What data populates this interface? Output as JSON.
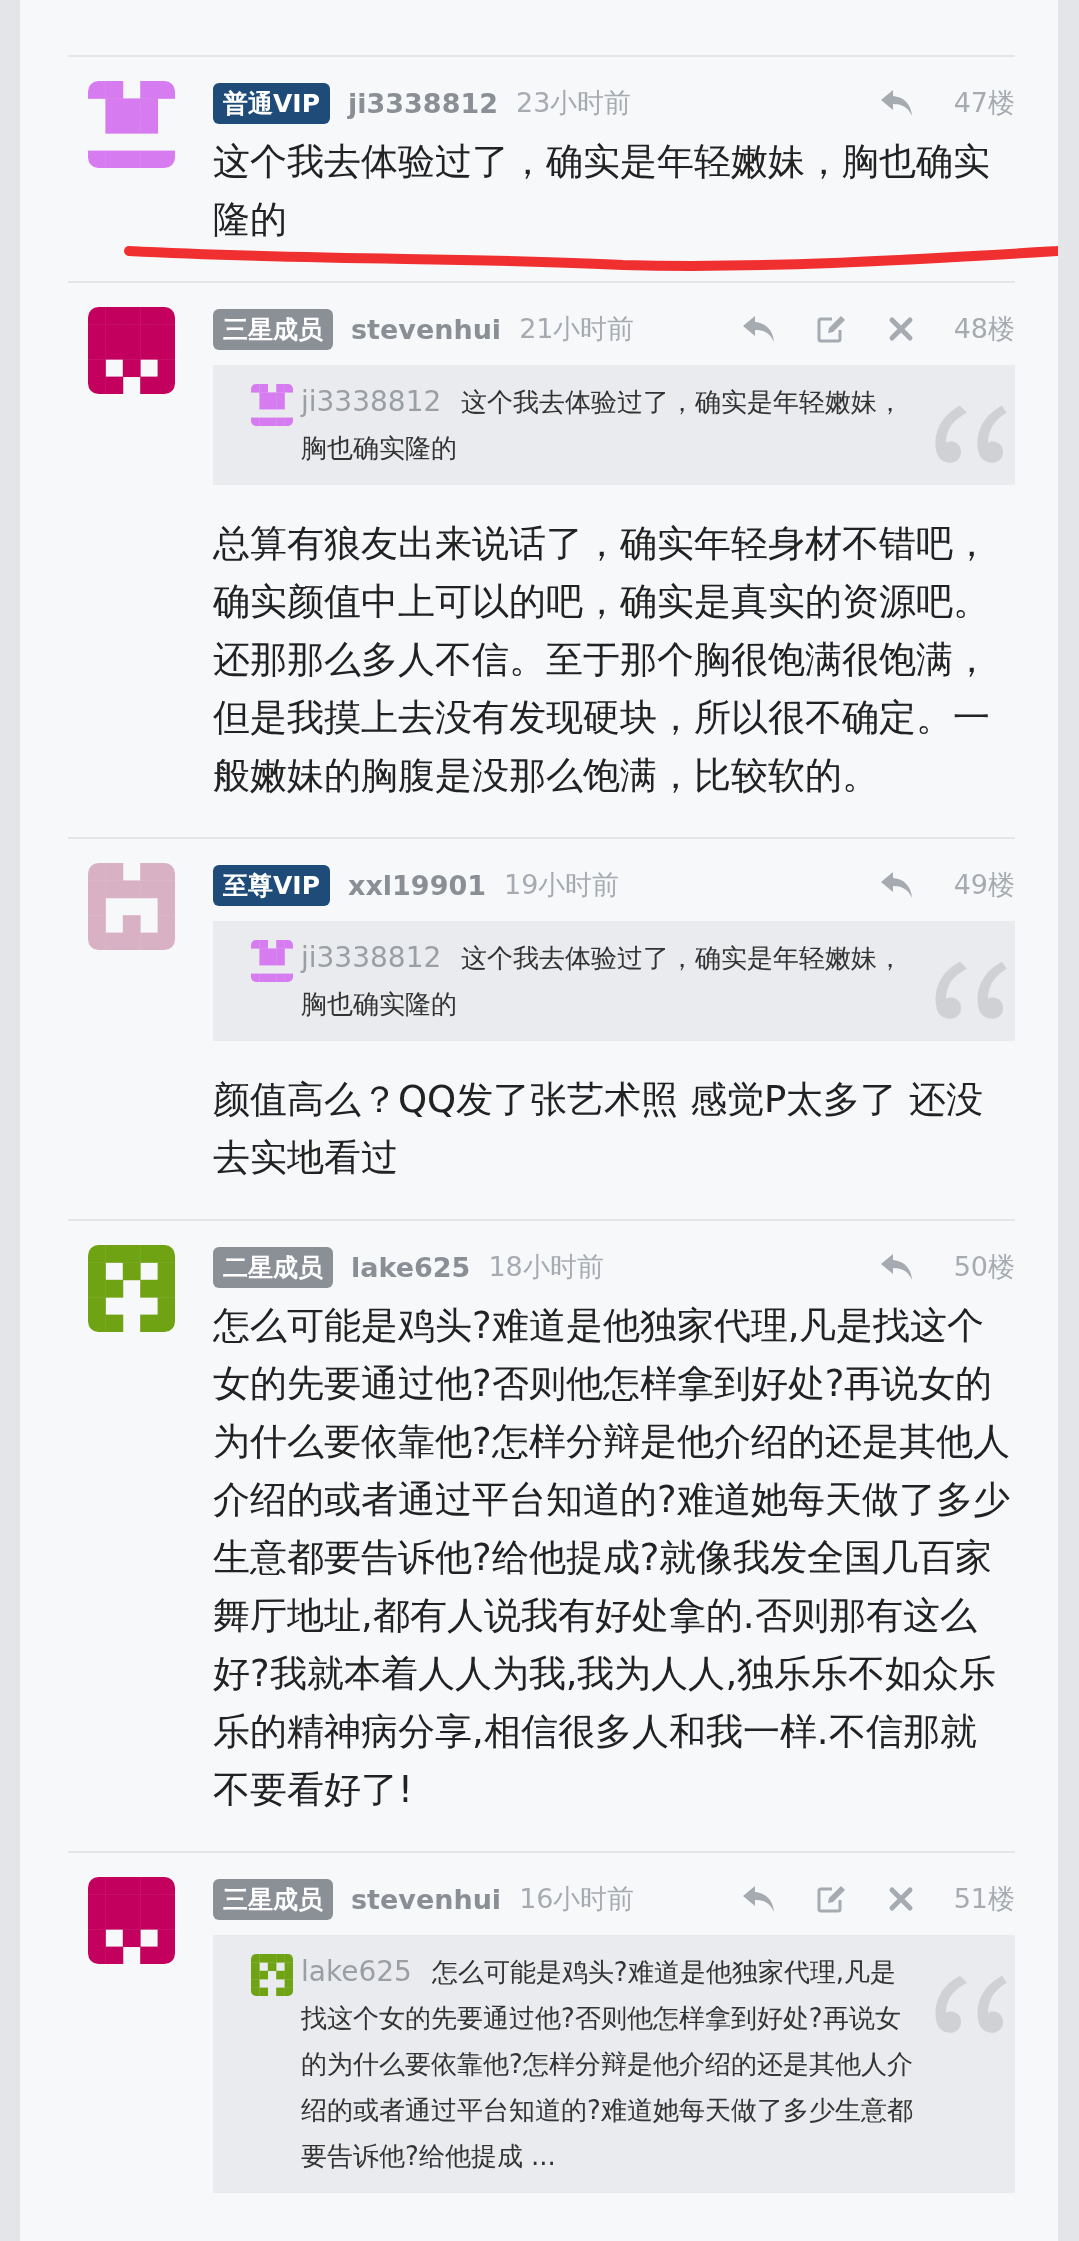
{
  "posts": [
    {
      "avatar": {
        "kind": "cup",
        "color": "#d77cf0"
      },
      "badge": {
        "label": "普通VIP",
        "color": "#1f4b78"
      },
      "username": "ji3338812",
      "time": "23小时前",
      "actions": [
        {
          "kind": "reply"
        }
      ],
      "floor": "47楼",
      "body": "这个我去体验过了，确实是年轻嫩妹，胸也确实隆的",
      "underlined": true
    },
    {
      "avatar": {
        "kind": "block",
        "color": "#c4005e"
      },
      "badge": {
        "label": "三星成员",
        "color": "#8b9097"
      },
      "username": "stevenhui",
      "time": "21小时前",
      "actions": [
        {
          "kind": "reply"
        },
        {
          "kind": "edit"
        },
        {
          "kind": "delete"
        }
      ],
      "floor": "48楼",
      "quote": {
        "avatar": {
          "kind": "cup",
          "color": "#d77cf0"
        },
        "username": "ji3338812",
        "text": "这个我去体验过了，确实是年轻嫩妹，胸也确实隆的"
      },
      "body": "总算有狼友出来说话了，确实年轻身材不错吧，确实颜值中上可以的吧，确实是真实的资源吧。还那那么多人不信。至于那个胸很饱满很饱满，但是我摸上去没有发现硬块，所以很不确定。一般嫩妹的胸腹是没那么饱满，比较软的。"
    },
    {
      "avatar": {
        "kind": "gate",
        "color": "#d9b1c4"
      },
      "badge": {
        "label": "至尊VIP",
        "color": "#1f4b78"
      },
      "username": "xxl19901",
      "time": "19小时前",
      "actions": [
        {
          "kind": "reply"
        }
      ],
      "floor": "49楼",
      "quote": {
        "avatar": {
          "kind": "cup",
          "color": "#d77cf0"
        },
        "username": "ji3338812",
        "text": "这个我去体验过了，确实是年轻嫩妹，胸也确实隆的"
      },
      "body": "颜值高么？QQ发了张艺术照 感觉P太多了 还没去实地看过"
    },
    {
      "avatar": {
        "kind": "face",
        "color": "#6fa314"
      },
      "badge": {
        "label": "二星成员",
        "color": "#8b9097"
      },
      "username": "lake625",
      "time": "18小时前",
      "actions": [
        {
          "kind": "reply"
        }
      ],
      "floor": "50楼",
      "body": "怎么可能是鸡头?难道是他独家代理,凡是找这个女的先要通过他?否则他怎样拿到好处?再说女的为什么要依靠他?怎样分辩是他介绍的还是其他人介绍的或者通过平台知道的?难道她每天做了多少生意都要告诉他?给他提成?就像我发全国几百家舞厅地址,都有人说我有好处拿的.否则那有这么好?我就本着人人为我,我为人人,独乐乐不如众乐乐的精神病分享,相信很多人和我一样.不信那就不要看好了!"
    },
    {
      "avatar": {
        "kind": "block",
        "color": "#c4005e"
      },
      "badge": {
        "label": "三星成员",
        "color": "#8b9097"
      },
      "username": "stevenhui",
      "time": "16小时前",
      "actions": [
        {
          "kind": "reply"
        },
        {
          "kind": "edit"
        },
        {
          "kind": "delete"
        }
      ],
      "floor": "51楼",
      "quote": {
        "avatar": {
          "kind": "face",
          "color": "#6fa314"
        },
        "username": "lake625",
        "text": "怎么可能是鸡头?难道是他独家代理,凡是找这个女的先要通过他?否则他怎样拿到好处?再说女的为什么要依靠他?怎样分辩是他介绍的还是其他人介绍的或者通过平台知道的?难道她每天做了多少生意都要告诉他?给他提成 ..."
      }
    }
  ]
}
